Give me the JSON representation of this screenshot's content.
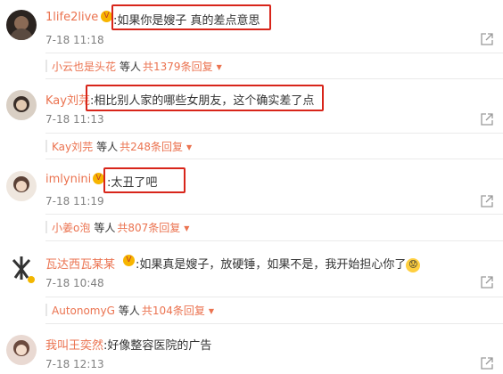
{
  "comments": [
    {
      "username": "1life2live",
      "text": ":如果你是嫂子 真的差点意思",
      "time": "7-18 11:18",
      "reply": {
        "name": "小云也是头花",
        "mid": "等人",
        "count": "共1379条回复"
      }
    },
    {
      "username": "Kay刘芫",
      "text": ":相比别人家的哪些女朋友，这个确实差了点",
      "time": "7-18 11:13",
      "reply": {
        "name": "Kay刘芫",
        "mid": "等人",
        "count": "共248条回复"
      }
    },
    {
      "username": "imlynini",
      "text": ":太丑了吧",
      "time": "7-18 11:19",
      "reply": {
        "name": "小姜o泡",
        "mid": "等人",
        "count": "共807条回复"
      }
    },
    {
      "username": "瓦达西瓦某某",
      "text": ":如果真是嫂子，放硬锤，如果不是，我开始担心你了",
      "time": "7-18 10:48",
      "reply": {
        "name": "AutonomyG",
        "mid": "等人",
        "count": "共104条回复"
      }
    },
    {
      "username": "我叫王奕然",
      "text": ":好像整容医院的广告",
      "time": "7-18 12:13"
    }
  ],
  "icons": {
    "share": "share-icon",
    "expand": "caret-down-icon",
    "vip": "vip-badge-icon"
  },
  "colors": {
    "username": "#eb7350",
    "highlight": "#d8251a",
    "time": "#808080"
  }
}
